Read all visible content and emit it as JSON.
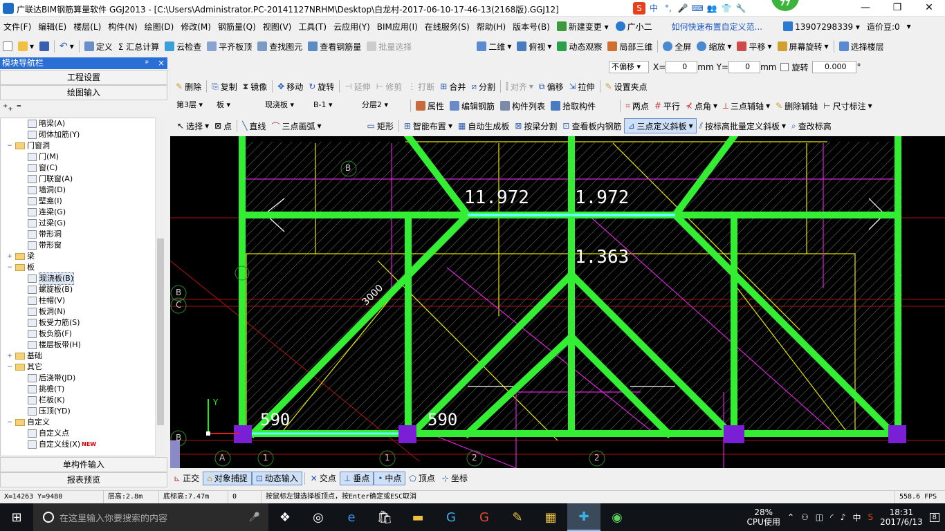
{
  "window": {
    "title": "广联达BIM钢筋算量软件 GGJ2013 - [C:\\Users\\Administrator.PC-20141127NRHM\\Desktop\\白龙村-2017-06-10-17-46-13(2168版).GGJ12]",
    "badge": "77",
    "ime": [
      "S",
      "中",
      "°,",
      "🎤",
      "⌨",
      "👥",
      "👕",
      "🔧"
    ],
    "controls": {
      "minimize": "—",
      "maximize": "❐",
      "close": "✕"
    }
  },
  "menu": {
    "items": [
      "文件(F)",
      "编辑(E)",
      "楼层(L)",
      "构件(N)",
      "绘图(D)",
      "修改(M)",
      "钢筋量(Q)",
      "视图(V)",
      "工具(T)",
      "云应用(Y)",
      "BIM应用(I)",
      "在线服务(S)",
      "帮助(H)",
      "版本号(B)"
    ],
    "new_change": "新建变更",
    "xiaoer": "广小二",
    "hint_link": "如何快速布置自定义范...",
    "phone": "13907298339",
    "price_bean": "造价豆:0"
  },
  "toolbar1": {
    "items": [
      "定义",
      "Σ 汇总计算",
      "云检查",
      "平齐板顶",
      "查找图元",
      "查看钢筋量",
      "批量选择"
    ],
    "right": [
      "二维",
      "俯视",
      "动态观察",
      "局部三维",
      "全屏",
      "缩放",
      "平移",
      "屏幕旋转",
      "选择楼层"
    ]
  },
  "coord_bar": {
    "offset_mode": "不偏移",
    "x_label": "X=",
    "x_value": "0",
    "x_unit": "mm",
    "y_label": "Y=",
    "y_value": "0",
    "y_unit": "mm",
    "rotate_label": "旋转",
    "rotate_value": "0.000",
    "rotate_unit": "°"
  },
  "toolbar2": {
    "items": [
      "删除",
      "复制",
      "镜像",
      "移动",
      "旋转",
      "延伸",
      "修剪",
      "打断",
      "合并",
      "分割",
      "对齐",
      "偏移",
      "拉伸",
      "设置夹点"
    ]
  },
  "toolbar3": {
    "floor": "第3层",
    "category": "板",
    "type": "现浇板",
    "component": "B-1",
    "layer": "分层2",
    "items": [
      "属性",
      "编辑钢筋",
      "构件列表",
      "拾取构件"
    ],
    "right": [
      "两点",
      "平行",
      "点角",
      "三点辅轴",
      "删除辅轴",
      "尺寸标注"
    ]
  },
  "toolbar4": {
    "items": [
      "选择",
      "点",
      "直线",
      "三点画弧",
      "矩形",
      "智能布置",
      "自动生成板",
      "按梁分割",
      "查看板内钢筋",
      "三点定义斜板",
      "按标高批量定义斜板",
      "查改标高"
    ]
  },
  "sidebar": {
    "title": "模块导航栏",
    "pin": "ᵖ",
    "close": "×",
    "btn_project": "工程设置",
    "btn_draw": "绘图输入",
    "btn_single": "单构件输入",
    "btn_report": "报表预览",
    "tree": [
      {
        "indent": 2,
        "kind": "item",
        "label": "暗梁(A)"
      },
      {
        "indent": 2,
        "kind": "item",
        "label": "砌体加筋(Y)"
      },
      {
        "indent": 1,
        "kind": "folder",
        "toggle": "−",
        "label": "门窗洞"
      },
      {
        "indent": 2,
        "kind": "item",
        "label": "门(M)"
      },
      {
        "indent": 2,
        "kind": "item",
        "label": "窗(C)"
      },
      {
        "indent": 2,
        "kind": "item",
        "label": "门联窗(A)"
      },
      {
        "indent": 2,
        "kind": "item",
        "label": "墙洞(D)"
      },
      {
        "indent": 2,
        "kind": "item",
        "label": "壁龛(I)"
      },
      {
        "indent": 2,
        "kind": "item",
        "label": "连梁(G)"
      },
      {
        "indent": 2,
        "kind": "item",
        "label": "过梁(G)"
      },
      {
        "indent": 2,
        "kind": "item",
        "label": "带形洞"
      },
      {
        "indent": 2,
        "kind": "item",
        "label": "带形窗"
      },
      {
        "indent": 1,
        "kind": "folder",
        "toggle": "+",
        "label": "梁"
      },
      {
        "indent": 1,
        "kind": "folder",
        "toggle": "−",
        "label": "板"
      },
      {
        "indent": 2,
        "kind": "item",
        "label": "现浇板(B)",
        "selected": true
      },
      {
        "indent": 2,
        "kind": "item",
        "label": "螺旋板(B)"
      },
      {
        "indent": 2,
        "kind": "item",
        "label": "柱帽(V)"
      },
      {
        "indent": 2,
        "kind": "item",
        "label": "板洞(N)"
      },
      {
        "indent": 2,
        "kind": "item",
        "label": "板受力筋(S)"
      },
      {
        "indent": 2,
        "kind": "item",
        "label": "板负筋(F)"
      },
      {
        "indent": 2,
        "kind": "item",
        "label": "楼层板带(H)"
      },
      {
        "indent": 1,
        "kind": "folder",
        "toggle": "+",
        "label": "基础"
      },
      {
        "indent": 1,
        "kind": "folder",
        "toggle": "−",
        "label": "其它"
      },
      {
        "indent": 2,
        "kind": "item",
        "label": "后浇带(JD)"
      },
      {
        "indent": 2,
        "kind": "item",
        "label": "挑檐(T)"
      },
      {
        "indent": 2,
        "kind": "item",
        "label": "栏板(K)"
      },
      {
        "indent": 2,
        "kind": "item",
        "label": "压顶(YD)"
      },
      {
        "indent": 1,
        "kind": "folder",
        "toggle": "−",
        "label": "自定义"
      },
      {
        "indent": 2,
        "kind": "item",
        "label": "自定义点"
      },
      {
        "indent": 2,
        "kind": "item",
        "label": "自定义线(X)",
        "new": "NEW"
      }
    ]
  },
  "canvas": {
    "labels": {
      "elev1": "11.972",
      "elev2": "1.972",
      "elev3": "1.363",
      "dim_3000": "3000",
      "dim_590a": "590",
      "dim_590b": "590",
      "axis_y": "Y"
    },
    "axes": {
      "b_top": "B",
      "b_left": "B",
      "c_left": "C",
      "b_bottom": "B",
      "a": "A",
      "n1a": "1",
      "n1b": "1",
      "n2a": "2",
      "n2b": "2"
    }
  },
  "bottom_toolbar": {
    "items": [
      "正交",
      "对象捕捉",
      "动态输入",
      "交点",
      "垂点",
      "中点",
      "顶点",
      "坐标"
    ]
  },
  "status": {
    "coords": "X=14263 Y=9480",
    "floor_height": "层高:2.8m",
    "bottom_elev": "底标高:7.47m",
    "zero": "0",
    "message": "按鼠标左键选择板顶点，按Enter确定或ESC取消",
    "fps": "558.6 FPS"
  },
  "taskbar": {
    "search_placeholder": "在这里输入你要搜索的内容",
    "cpu_percent": "28%",
    "cpu_label": "CPU使用",
    "lang": "中",
    "time": "18:31",
    "date": "2017/6/13",
    "notif": "8"
  },
  "colors": {
    "canvas_bg": "#000000",
    "beam": "#33ee33",
    "yellow": "#eeee00",
    "magenta": "#dd22dd",
    "red": "#cc1111",
    "column": "#7a1fd6",
    "sidebar_head": "#2a6fd6"
  }
}
